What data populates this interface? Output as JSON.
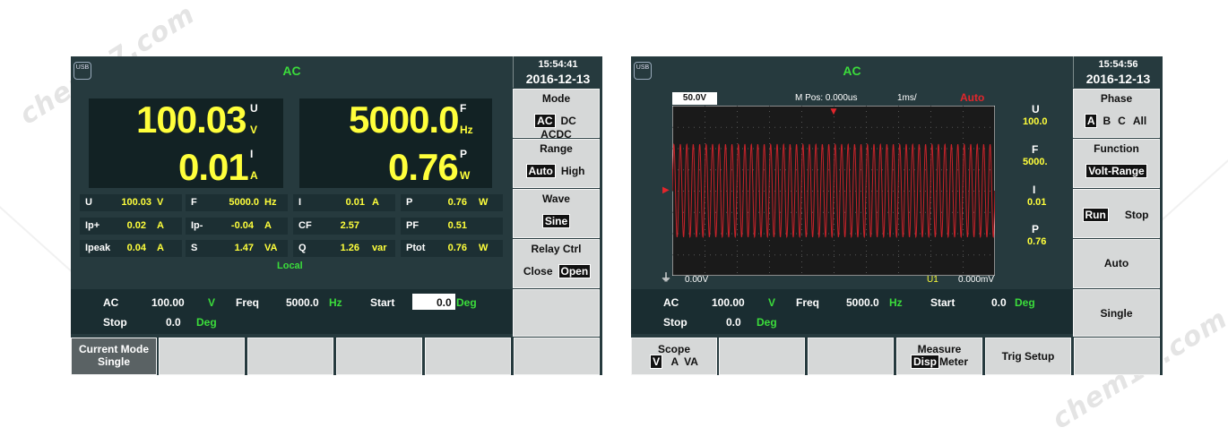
{
  "watermarks": [
    "chem17.com",
    "chem17.com"
  ],
  "left": {
    "title": "AC",
    "usb": "USB",
    "time": "15:54:41",
    "date": "2016-12-13",
    "big": {
      "u_value": "100.03",
      "u_sup": "U",
      "u_sub": "V",
      "f_value": "5000.0",
      "f_sup": "F",
      "f_sub": "Hz",
      "i_value": "0.01",
      "i_sup": "I",
      "i_sub": "A",
      "p_value": "0.76",
      "p_sup": "P",
      "p_sub": "W"
    },
    "table": [
      [
        [
          "U",
          "100.03",
          "V"
        ],
        [
          "F",
          "5000.0",
          "Hz"
        ],
        [
          "I",
          "0.01",
          "A"
        ],
        [
          "P",
          "0.76",
          "W"
        ]
      ],
      [
        [
          "Ip+",
          "0.02",
          "A"
        ],
        [
          "Ip-",
          "-0.04",
          "A"
        ],
        [
          "CF",
          "2.57",
          ""
        ],
        [
          "PF",
          "0.51",
          ""
        ]
      ],
      [
        [
          "Ipeak",
          "0.04",
          "A"
        ],
        [
          "S",
          "1.47",
          "VA"
        ],
        [
          "Q",
          "1.26",
          "var"
        ],
        [
          "Ptot",
          "0.76",
          "W"
        ]
      ]
    ],
    "local": "Local",
    "params": {
      "ac": "AC",
      "ac_val": "100.00",
      "ac_unit": "V",
      "freq": "Freq",
      "freq_val": "5000.0",
      "freq_unit": "Hz",
      "start": "Start",
      "start_val": "0.0",
      "start_unit": "Deg",
      "stop": "Stop",
      "stop_val": "0.0",
      "stop_unit": "Deg"
    },
    "side": {
      "mode": {
        "title": "Mode",
        "opts": [
          "AC",
          "DC",
          "ACDC"
        ],
        "selected": "AC"
      },
      "range": {
        "title": "Range",
        "opts": [
          "Auto",
          "High"
        ],
        "selected": "Auto"
      },
      "wave": {
        "title": "Wave",
        "opts": [
          "Sine"
        ],
        "selected": "Sine"
      },
      "relay": {
        "title": "Relay Ctrl",
        "opts": [
          "Close",
          "Open"
        ],
        "selected": "Open"
      }
    },
    "bottom": {
      "b1_line1": "Current Mode",
      "b1_line2": "Single"
    }
  },
  "right": {
    "title": "AC",
    "usb": "USB",
    "time": "15:54:56",
    "date": "2016-12-13",
    "scope_header": {
      "volt": "50.0V",
      "mpos": "M Pos: 0.000us",
      "timebase": "1ms/",
      "trig": "Auto"
    },
    "scope_footer": {
      "offset": "0.00V",
      "channel": "U1",
      "reading": "0.000mV"
    },
    "readouts": [
      {
        "label": "U",
        "value": "100.0"
      },
      {
        "label": "F",
        "value": "5000."
      },
      {
        "label": "I",
        "value": "0.01"
      },
      {
        "label": "P",
        "value": "0.76"
      }
    ],
    "params": {
      "ac": "AC",
      "ac_val": "100.00",
      "ac_unit": "V",
      "freq": "Freq",
      "freq_val": "5000.0",
      "freq_unit": "Hz",
      "start": "Start",
      "start_val": "0.0",
      "start_unit": "Deg",
      "stop": "Stop",
      "stop_val": "0.0",
      "stop_unit": "Deg"
    },
    "side": {
      "phase": {
        "title": "Phase",
        "opts": [
          "A",
          "B",
          "C",
          "All"
        ],
        "selected": "A"
      },
      "function": {
        "title": "Function",
        "opts": [
          "Volt-Range"
        ],
        "selected": "Volt-Range"
      },
      "run": {
        "opts": [
          "Run",
          "Stop"
        ],
        "selected": "Run"
      },
      "auto": "Auto",
      "single": "Single"
    },
    "bottom": {
      "scope": {
        "title": "Scope",
        "opts": [
          "V",
          "A",
          "VA"
        ],
        "selected": "V"
      },
      "measure": {
        "title": "Measure",
        "opts": [
          "Disp",
          "Meter"
        ],
        "selected": "Disp"
      },
      "trig": "Trig Setup"
    },
    "colors": {
      "wave": "#c8232a",
      "trace_bg": "#1a1a1a"
    }
  }
}
